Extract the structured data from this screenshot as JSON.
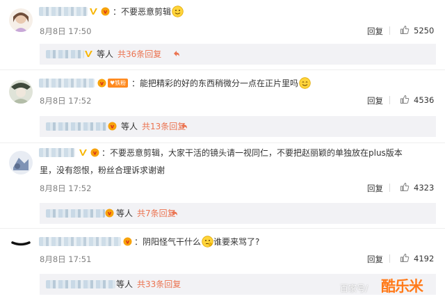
{
  "comments": [
    {
      "text": "：不要恶意剪辑",
      "time": "8月8日 17:50",
      "reply_label": "回复",
      "likes": "5250",
      "thread": {
        "suffix": "等人",
        "total": "共36条回复"
      }
    },
    {
      "badge": "♥铁粉",
      "text": "：能把精彩的好的东西稍微分一点在正片里吗",
      "time": "8月8日 17:52",
      "reply_label": "回复",
      "likes": "4536",
      "thread": {
        "suffix": "等人",
        "total": "共13条回复"
      }
    },
    {
      "text_line1": "：不要恶意剪辑，大家干活的镜头请一视同仁，不要把赵丽颖的单独放在plus版本",
      "text_line2": "里，没有怨恨，粉丝合理诉求谢谢",
      "time": "8月8日 17:52",
      "reply_label": "回复",
      "likes": "4323",
      "thread": {
        "suffix": "等人",
        "total": "共7条回复"
      }
    },
    {
      "text_a": "：阴阳怪气干什么",
      "text_b": "谁要来骂了?",
      "time": "8月8日 17:51",
      "reply_label": "回复",
      "likes": "4192",
      "thread": {
        "suffix": "等人",
        "total": "共33条回复"
      }
    }
  ],
  "watermark": {
    "source": "百家号/",
    "logo": "酷乐米"
  },
  "icons": {
    "vip": "vip-v-icon",
    "member": "member-badge-icon",
    "like": "thumbs-up-icon",
    "emoji": "smile-emoji-icon",
    "thinking": "thinking-emoji-icon",
    "arrow": "reply-arrow-icon"
  },
  "colors": {
    "link": "#eb7350",
    "vip": "#f7b500",
    "muted": "#808080"
  }
}
